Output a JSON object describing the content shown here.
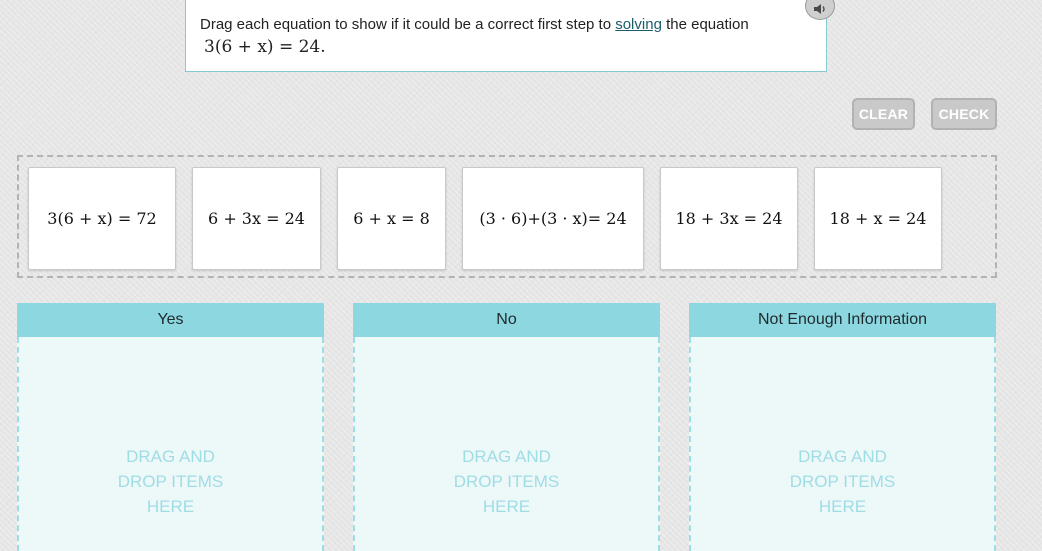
{
  "prompt": {
    "text_before": "Drag each equation to show if it could be a correct first step to ",
    "link_text": "solving",
    "text_after": " the equation",
    "equation": "3(6 + x) = 24",
    "equation_end": "."
  },
  "audio": {
    "icon": "speaker-icon"
  },
  "buttons": {
    "clear": "CLEAR",
    "check": "CHECK"
  },
  "cards": [
    "3(6 + x) = 72",
    "6 + 3x = 24",
    "6 + x = 8",
    "(3 · 6)+(3 · x)= 24",
    "18 + 3x = 24",
    "18 + x = 24"
  ],
  "zones": [
    {
      "title": "Yes",
      "hint": "DRAG AND\nDROP ITEMS\nHERE"
    },
    {
      "title": "No",
      "hint": "DRAG AND\nDROP ITEMS\nHERE"
    },
    {
      "title": "Not Enough Information",
      "hint": "DRAG AND\nDROP ITEMS\nHERE"
    }
  ],
  "colors": {
    "zone_header": "#8dd7e1",
    "zone_body": "#edf8f9",
    "button_disabled": "#c9c9c9"
  }
}
